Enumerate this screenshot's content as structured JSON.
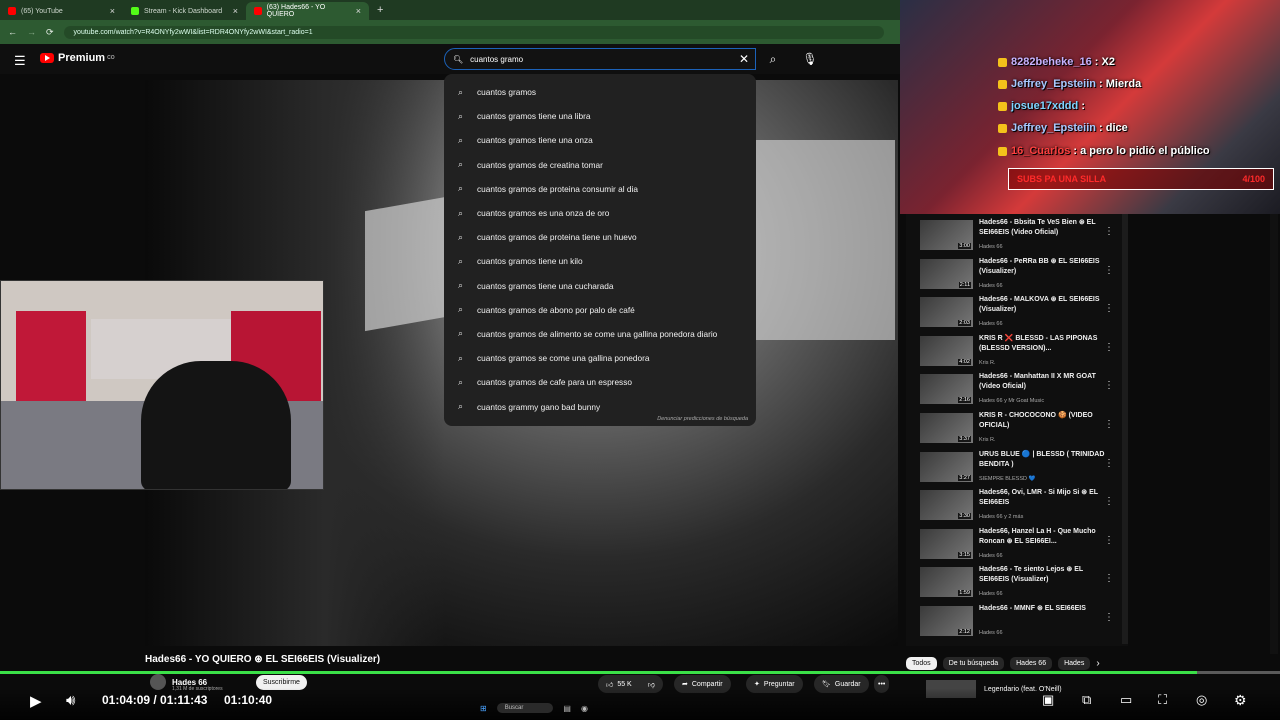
{
  "browser": {
    "tabs": [
      {
        "title": "(65) YouTube",
        "color": "#ff0000"
      },
      {
        "title": "Stream - Kick Dashboard",
        "color": "#53fc18"
      },
      {
        "title": "(63) Hades66 - YO QUIERO",
        "color": "#ff0000"
      }
    ],
    "new_tab": "+",
    "url": "youtube.com/watch?v=R4ONYfy2wWI&list=RDR4ONYfy2wWI&start_radio=1"
  },
  "youtube": {
    "logo_text": "Premium",
    "logo_sup": "CO",
    "search_value": "cuantos gramo",
    "suggestions": [
      "cuantos gramos",
      "cuantos gramos tiene una libra",
      "cuantos gramos tiene una onza",
      "cuantos gramos de creatina tomar",
      "cuantos gramos de proteina consumir al dia",
      "cuantos gramos es una onza de oro",
      "cuantos gramos de proteina tiene un huevo",
      "cuantos gramos tiene un kilo",
      "cuantos gramos tiene una cucharada",
      "cuantos gramos de abono por palo de café",
      "cuantos gramos de alimento se come una gallina ponedora diario",
      "cuantos gramos se come una gallina ponedora",
      "cuantos gramos de cafe para un espresso",
      "cuantos grammy gano bad bunny"
    ],
    "report_text": "Denunciar predicciones de búsqueda"
  },
  "video": {
    "title": "Hades66 - YO QUIERO ⊛ EL SEI66EIS (Visualizer)",
    "channel": "Hades 66",
    "subscribers": "1,31 M de suscriptores",
    "subscribe_label": "Suscribirme",
    "likes": "55 K",
    "share_label": "Compartir",
    "ask_label": "Preguntar",
    "save_label": "Guardar",
    "more_label": "•••",
    "progress": 0.935
  },
  "player": {
    "time": "01:04:09 / 01:11:43",
    "time_alt": "01:10:40"
  },
  "stream": {
    "chat": [
      {
        "user": "8282beheke_16",
        "msg": ": X2",
        "color": "#c8b3ff"
      },
      {
        "user": "Jeffrey_Epsteiin",
        "msg": ": Mierda",
        "color": "#a8c8ff"
      },
      {
        "user": "josue17xddd",
        "msg": ":",
        "color": "#7fd4ff"
      },
      {
        "user": "Jeffrey_Epsteiin",
        "msg": ": dice",
        "color": "#a8c8ff"
      },
      {
        "user": "16_Cuarlos",
        "msg": ": a pero lo pidió el público",
        "color": "#ff4040"
      }
    ],
    "sub_goal": "SUBS PA UNA SILLA",
    "sub_count": "4/100"
  },
  "playlist": [
    {
      "title": "Hades66 - Bbsita Te VeS Bien ⊛ EL SEI66EIS (Video Oficial)",
      "channel": "Hades 66",
      "duration": "3:00"
    },
    {
      "title": "Hades66 - PeRRa BB ⊛ EL SEI66EIS (Visualizer)",
      "channel": "Hades 66",
      "duration": "2:11"
    },
    {
      "title": "Hades66 - MALKOVA ⊛ EL SEI66EIS (Visualizer)",
      "channel": "Hades 66",
      "duration": "2:03"
    },
    {
      "title": "KRIS R ❌ BLESSD - LAS PIPONAS (BLESSD VERSION)...",
      "channel": "Kris R.",
      "duration": "4:02"
    },
    {
      "title": "Hades66 - Manhattan II X MR GOAT (Video Oficial)",
      "channel": "Hades 66 y Mr Goat Music",
      "duration": "2:16"
    },
    {
      "title": "KRIS R - CHOCOCONO 🍪 (VIDEO OFICIAL)",
      "channel": "Kris R.",
      "duration": "3:37"
    },
    {
      "title": "URUS BLUE 🔵 | BLESSD ( TRINIDAD BENDITA )",
      "channel": "SIEMPRE BLESSD 💙",
      "duration": "3:27"
    },
    {
      "title": "Hades66, Ovi, LMR - Si Mijo Si ⊛ EL SEI66EIS",
      "channel": "Hades 66 y 2 más",
      "duration": "3:30"
    },
    {
      "title": "Hades66, Hanzel La H - Que Mucho Roncan ⊛ EL SEI66EI...",
      "channel": "Hades 66",
      "duration": "3:15"
    },
    {
      "title": "Hades66 - Te siento Lejos ⊛ EL SEI66EIS (Visualizer)",
      "channel": "Hades 66",
      "duration": "1:59"
    },
    {
      "title": "Hades66 - MMNF ⊛ EL SEI66EIS",
      "channel": "Hades 66",
      "duration": "2:12"
    }
  ],
  "chips": [
    "Todos",
    "De tu búsqueda",
    "Hades 66",
    "Hades"
  ],
  "next_up": "Legendario (feat. O'Neill)",
  "taskbar": {
    "search": "Buscar"
  }
}
